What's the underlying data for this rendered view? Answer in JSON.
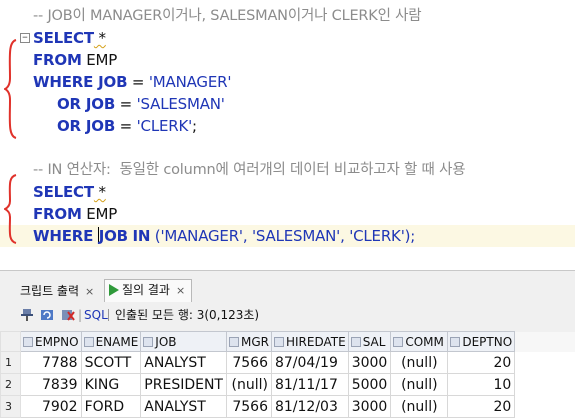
{
  "editor": {
    "query1": {
      "comment": "-- JOB이 MANAGER이거나, SALESMAN이거나 CLERK인 사람",
      "select_kw": "SELECT",
      "select_star": " *",
      "from_kw": "FROM",
      "table": " EMP",
      "where_kw": "WHERE",
      "col": " JOB",
      "eq": " = ",
      "v1": "'MANAGER'",
      "or_kw": "OR",
      "v2": "'SALESMAN'",
      "v3": "'CLERK'",
      "semi": ";"
    },
    "query2": {
      "comment": "-- IN 연산자:  동일한 column에 여러개의 데이터 비교하고자 할 때 사용",
      "select_kw": "SELECT",
      "select_star": " *",
      "from_kw": "FROM",
      "table": " EMP",
      "where_kw": "WHERE",
      "col": "JOB",
      "in_kw": "IN",
      "list": " ('MANAGER', 'SALESMAN', 'CLERK');"
    },
    "brace_color": "#e0322b"
  },
  "results_panel": {
    "tab_script_output": "크립트 출력",
    "tab_query_result": "질의 결과",
    "close_glyph": "×",
    "sql_label": "SQL",
    "fetch_status": "인출된 모든 행: 3(0,123초)"
  },
  "grid": {
    "columns": [
      "EMPNO",
      "ENAME",
      "JOB",
      "MGR",
      "HIREDATE",
      "SAL",
      "COMM",
      "DEPTNO"
    ],
    "rows": [
      {
        "n": "1",
        "cells": [
          "7788",
          "SCOTT",
          "ANALYST",
          "7566",
          "87/04/19",
          "3000",
          "(null)",
          "20"
        ]
      },
      {
        "n": "2",
        "cells": [
          "7839",
          "KING",
          "PRESIDENT",
          "(null)",
          "81/11/17",
          "5000",
          "(null)",
          "10"
        ]
      },
      {
        "n": "3",
        "cells": [
          "7902",
          "FORD",
          "ANALYST",
          "7566",
          "81/12/03",
          "3000",
          "(null)",
          "20"
        ]
      }
    ]
  }
}
